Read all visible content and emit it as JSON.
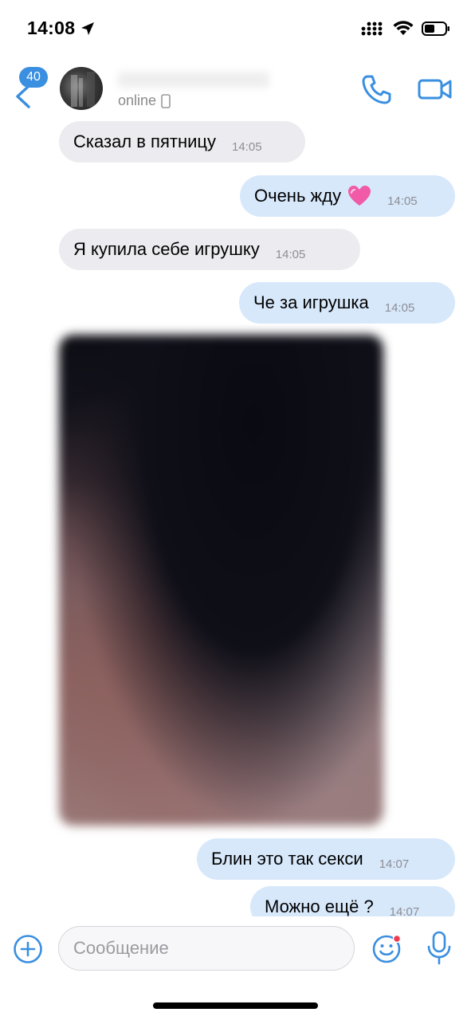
{
  "status_bar": {
    "time": "14:08"
  },
  "header": {
    "unread_count": "40",
    "presence": "online"
  },
  "messages": [
    {
      "direction": "in",
      "text": "Сказал в пятницу",
      "time": "14:05"
    },
    {
      "direction": "out",
      "text": "Очень жду",
      "emoji": "heart-icon",
      "time": "14:05"
    },
    {
      "direction": "in",
      "text": "Я купила себе игрушку",
      "time": "14:05"
    },
    {
      "direction": "out",
      "text": "Че за игрушка",
      "time": "14:05"
    },
    {
      "direction": "in",
      "type": "photo"
    },
    {
      "direction": "out",
      "text": "Блин это так секси",
      "time": "14:07"
    },
    {
      "direction": "out",
      "text": "Можно ещё ?",
      "time": "14:07"
    }
  ],
  "composer": {
    "placeholder": "Сообщение"
  },
  "colors": {
    "accent": "#3a8fe0",
    "incoming_bubble": "#ececf0",
    "outgoing_bubble": "#d7e8fb"
  }
}
